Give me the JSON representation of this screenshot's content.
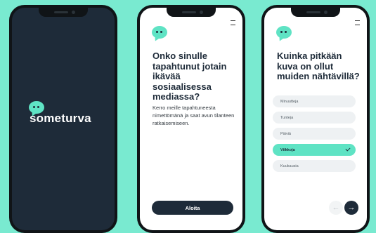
{
  "colors": {
    "background": "#79ead0",
    "accent": "#5fe3c4",
    "dark": "#1e2b39"
  },
  "splash": {
    "logo_icon": "speech-bubble-icon",
    "brand_name": "someturva"
  },
  "intro": {
    "logo_icon": "speech-bubble-icon",
    "menu_icon": "menu-icon",
    "heading": "Onko sinulle tapahtunut jotain ikävää sosiaalisessa mediassa?",
    "body": "Kerro meille tapahtuneesta nimettömänä ja saat avun tilanteen ratkaisemiseen.",
    "start_button": "Aloita"
  },
  "question": {
    "logo_icon": "speech-bubble-icon",
    "menu_icon": "menu-icon",
    "heading": "Kuinka pitkään kuva on ollut muiden nähtävillä?",
    "options": [
      {
        "label": "Minuutteja",
        "selected": false
      },
      {
        "label": "Tunteja",
        "selected": false
      },
      {
        "label": "Päiviä",
        "selected": false
      },
      {
        "label": "Viikkoja",
        "selected": true
      },
      {
        "label": "Kuukausia",
        "selected": false
      }
    ],
    "prev_icon": "←",
    "next_icon": "→"
  }
}
